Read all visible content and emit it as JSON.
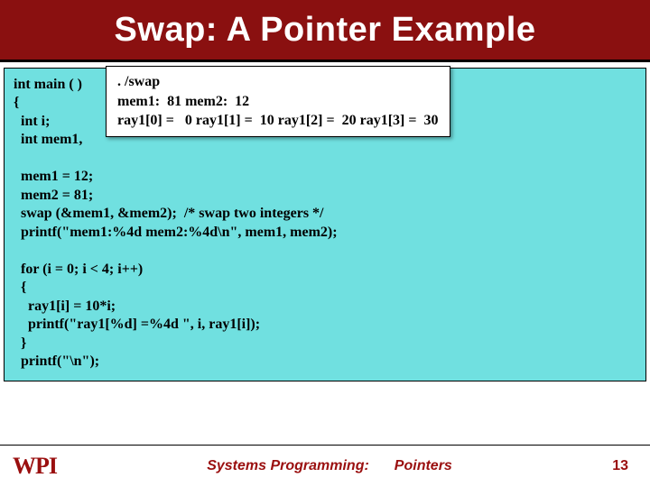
{
  "title": "Swap: A Pointer Example",
  "code": "int main ( )\n{\n  int i;\n  int mem1,\n\n  mem1 = 12;\n  mem2 = 81;\n  swap (&mem1, &mem2);  /* swap two integers */\n  printf(\"mem1:%4d mem2:%4d\\n\", mem1, mem2);\n\n  for (i = 0; i < 4; i++)\n  {\n    ray1[i] = 10*i;\n    printf(\"ray1[%d] =%4d \", i, ray1[i]);\n  }\n  printf(\"\\n\");",
  "output": ". /swap\nmem1:  81 mem2:  12\nray1[0] =   0 ray1[1] =  10 ray1[2] =  20 ray1[3] =  30",
  "footer": {
    "logo": "WPI",
    "left": "Systems Programming:",
    "right": "Pointers",
    "page": "13"
  }
}
